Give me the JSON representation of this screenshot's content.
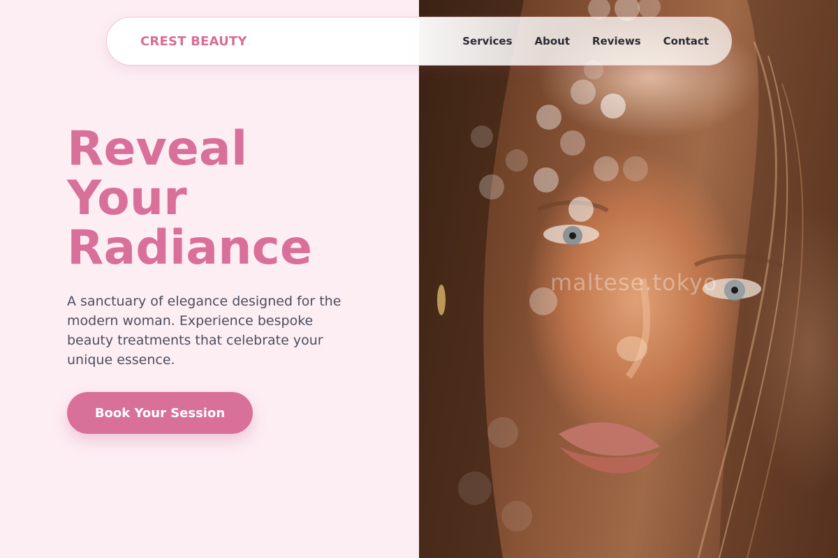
{
  "brand": {
    "name": "CREST BEAUTY",
    "accent_color": "#d8709a"
  },
  "nav": {
    "links": [
      "Services",
      "About",
      "Reviews",
      "Contact"
    ]
  },
  "hero": {
    "title_lines": [
      "Reveal",
      "Your",
      "Radiance"
    ],
    "description": "A sanctuary of elegance designed for the modern woman. Experience bespoke beauty treatments that celebrate your unique essence.",
    "cta_label": "Book Your Session"
  },
  "photo": {
    "watermark": "maltese.tokyo"
  }
}
